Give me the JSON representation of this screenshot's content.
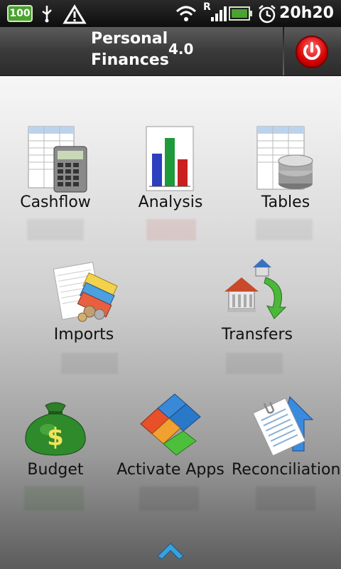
{
  "status_bar": {
    "battery_level": "100",
    "network_label": "R",
    "time": "20h20",
    "icons": [
      "battery-icon",
      "usb-icon",
      "warning-icon",
      "wifi-icon",
      "signal-icon",
      "battery-charge-icon",
      "alarm-icon"
    ]
  },
  "header": {
    "title": "Personal Finances",
    "version": "4.0",
    "power_icon": "power-icon"
  },
  "menu": {
    "items": [
      {
        "label": "Cashflow",
        "icon": "cashflow-icon"
      },
      {
        "label": "Analysis",
        "icon": "analysis-icon"
      },
      {
        "label": "Tables",
        "icon": "tables-icon"
      },
      {
        "label": "Imports",
        "icon": "imports-icon"
      },
      {
        "label": "Transfers",
        "icon": "transfers-icon"
      },
      {
        "label": "Budget",
        "icon": "budget-icon"
      },
      {
        "label": "Activate Apps",
        "icon": "activate-apps-icon"
      },
      {
        "label": "Reconciliation",
        "icon": "reconciliation-icon"
      }
    ]
  },
  "footer": {
    "icon": "chevron-up-icon"
  },
  "colors": {
    "accent_red": "#d40000",
    "status_green": "#4aa32e",
    "chevron_blue": "#3aa0e0"
  }
}
